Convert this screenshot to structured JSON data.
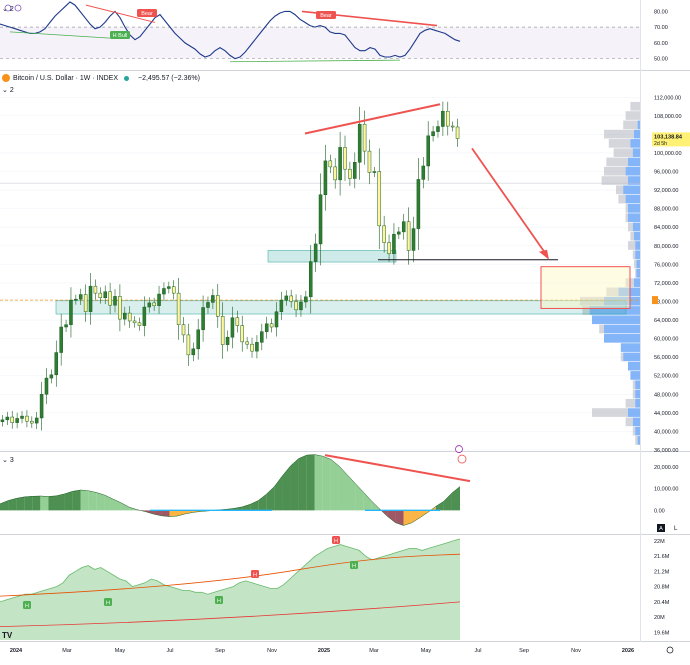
{
  "chart_data": [
    {
      "type": "line",
      "pane": "rsi",
      "pane_label": "2",
      "y_ticks": [
        "80.00",
        "70.00",
        "60.00",
        "50.00"
      ],
      "ylim": [
        44,
        86
      ],
      "overbought": 70,
      "oversold": 50,
      "rsi_values": [
        72,
        71,
        70,
        69,
        68,
        67,
        66,
        66,
        67,
        69,
        73,
        77,
        80,
        83,
        86,
        84,
        80,
        76,
        72,
        69,
        70,
        73,
        77,
        80,
        76,
        70,
        65,
        62,
        64,
        68,
        72,
        76,
        78,
        74,
        70,
        66,
        63,
        60,
        58,
        56,
        53,
        51,
        52,
        55,
        57,
        55,
        52,
        50,
        51,
        54,
        58,
        62,
        66,
        70,
        74,
        77,
        79,
        80,
        80,
        78,
        75,
        73,
        71,
        70,
        71,
        70,
        67,
        66,
        66,
        65,
        61,
        57,
        55,
        55,
        57,
        56,
        52,
        51,
        51,
        52,
        51,
        52,
        56,
        61,
        66,
        68,
        69,
        68,
        67,
        66,
        64,
        62,
        61
      ],
      "labels": [
        "Bear",
        "H Bull",
        "Bear"
      ]
    },
    {
      "type": "candlestick",
      "pane": "price",
      "pane_label": "2",
      "title": "Bitcoin / U.S. Dollar · 1W · INDEX",
      "change": "−2,495.57 (−2.36%)",
      "last_price": "103,138.84",
      "countdown": "2d 5h",
      "ylim": [
        36000,
        114000
      ],
      "y_ticks": [
        "112,000.00",
        "108,000.00",
        "104,000.00",
        "100,000.00",
        "96,000.00",
        "92,000.00",
        "88,000.00",
        "84,000.00",
        "80,000.00",
        "76,000.00",
        "72,000.00",
        "68,000.00",
        "64,000.00",
        "60,000.00",
        "56,000.00",
        "52,000.00",
        "48,000.00",
        "44,000.00",
        "40,000.00",
        "36,000.00"
      ],
      "x_ticks": [
        "2024",
        "Mar",
        "May",
        "Jul",
        "Sep",
        "Nov",
        "2025",
        "Mar",
        "May",
        "Jul",
        "Sep",
        "Nov",
        "2026"
      ],
      "closes": [
        42500,
        43100,
        41900,
        42800,
        43300,
        42200,
        41800,
        42900,
        48000,
        51500,
        52200,
        57000,
        62500,
        63000,
        68300,
        68500,
        69500,
        65800,
        71300,
        69800,
        68800,
        70100,
        67200,
        69100,
        64200,
        65500,
        63800,
        63400,
        62800,
        66800,
        67700,
        67100,
        69600,
        70800,
        71200,
        69800,
        63000,
        60800,
        56500,
        57800,
        61900,
        66700,
        67800,
        69300,
        64800,
        58700,
        60300,
        64500,
        62800,
        59300,
        58800,
        57300,
        59200,
        61500,
        63200,
        62500,
        65800,
        68300,
        69200,
        68000,
        66200,
        67900,
        69000,
        76600,
        80400,
        91000,
        98300,
        97000,
        94200,
        101200,
        96500,
        94500,
        98000,
        106200,
        100400,
        95800,
        96000,
        84300,
        80700,
        78300,
        82500,
        83000,
        85200,
        79000,
        83700,
        94300,
        97200,
        103700,
        104600,
        105700,
        109000,
        105800,
        105600,
        103100
      ],
      "max_high": "112,000.00",
      "range_box": [
        "68,000.00",
        "76,000.00"
      ]
    },
    {
      "type": "area",
      "pane": "momentum",
      "pane_label": "3",
      "y_ticks": [
        "20,000.00",
        "10,000.00",
        "0.00"
      ],
      "ylim": [
        -10000,
        26000
      ],
      "values": [
        3000,
        4500,
        5500,
        6200,
        6500,
        6600,
        6400,
        6700,
        7600,
        8800,
        9400,
        9000,
        8200,
        7000,
        5200,
        3500,
        1500,
        300,
        -600,
        -1700,
        -2500,
        -2900,
        -2600,
        -1600,
        -900,
        -500,
        -200,
        200,
        500,
        900,
        1600,
        2800,
        4500,
        7400,
        11000,
        16000,
        20500,
        23900,
        25500,
        25700,
        25000,
        23500,
        20500,
        16500,
        12500,
        8500,
        4500,
        800,
        -2800,
        -5700,
        -7000,
        -5800,
        -3500,
        -1000,
        1800,
        4200,
        8000,
        11000
      ],
      "legend_badge": "A",
      "log_label": "L"
    },
    {
      "type": "area",
      "pane": "volume",
      "y_ticks": [
        "22M",
        "21.6M",
        "21.2M",
        "20.8M",
        "20.4M",
        "20M",
        "19.6M"
      ],
      "ylim": [
        19400000,
        22100000
      ],
      "values": [
        20400000,
        20450000,
        20500000,
        20550000,
        20600000,
        20600000,
        20650000,
        20700000,
        20750000,
        20800000,
        20900000,
        21100000,
        21200000,
        21300000,
        21350000,
        21250000,
        21300000,
        21200000,
        21100000,
        21000000,
        20950000,
        20800000,
        20850000,
        20900000,
        21000000,
        20950000,
        20850000,
        20800000,
        20750000,
        20700000,
        20700000,
        20650000,
        20650000,
        20600000,
        20650000,
        20700000,
        20750000,
        20800000,
        20900000,
        20950000,
        20900000,
        20850000,
        20800000,
        20750000,
        20750000,
        20850000,
        21000000,
        21150000,
        21300000,
        21450000,
        21600000,
        21700000,
        21800000,
        21850000,
        21900000,
        21850000,
        21800000,
        21750000,
        21600000,
        21500000,
        21550000,
        21600000,
        21650000,
        21700000,
        21750000,
        21800000,
        21800000,
        21750000,
        21800000,
        21850000,
        21900000,
        21950000,
        22000000,
        22050000
      ],
      "badges": [
        "H",
        "H",
        "H",
        "H",
        "H",
        "H",
        "H"
      ]
    }
  ],
  "ui": {
    "symbol": "Bitcoin / U.S. Dollar · 1W · INDEX",
    "change": "−2,495.57 (−2.36%)",
    "last_price": "103,138.84",
    "countdown": "2d 5h",
    "tv_logo": "TV",
    "pane_rsi": "2",
    "pane_price": "2",
    "pane_momentum": "3",
    "scale_auto": "A",
    "scale_log": "L"
  }
}
